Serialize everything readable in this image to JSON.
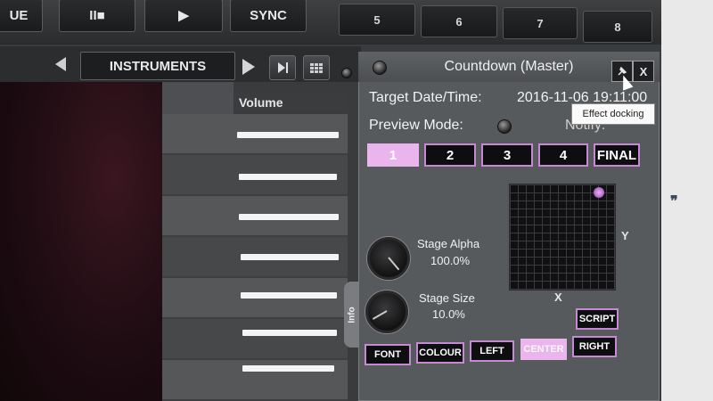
{
  "transport": {
    "cue_label": "UE",
    "play_pause_label": "II■",
    "play_label": "▶",
    "sync_label": "SYNC"
  },
  "hotcues": [
    "5",
    "6",
    "7",
    "8"
  ],
  "instruments": {
    "title": "INSTRUMENTS",
    "column_header": "Volume",
    "volume_levels": [
      0.95,
      0.92,
      0.93,
      0.92,
      0.9,
      0.88,
      0.86
    ]
  },
  "info_tab": "Info",
  "countdown": {
    "title": "Countdown (Master)",
    "target_label": "Target Date/Time:",
    "target_value": "2016-11-06 19:11:00",
    "preview_label": "Preview Mode:",
    "notify_label": "Notify:",
    "tooltip": "Effect docking",
    "close_label": "X",
    "stage_buttons": [
      "1",
      "2",
      "3",
      "4",
      "FINAL"
    ],
    "active_stage": "1",
    "stage_alpha_label": "Stage Alpha",
    "stage_alpha_value": "100.0%",
    "stage_size_label": "Stage Size",
    "stage_size_value": "10.0%",
    "script_label": "SCRIPT",
    "font_label": "FONT",
    "colour_label": "COLOUR",
    "left_label": "LEFT",
    "center_label": "CENTER",
    "right_label": "RIGHT",
    "x_label": "X",
    "y_label": "Y"
  },
  "side_glyph": "❞",
  "colors": {
    "accent": "#c58ad3",
    "active": "#e9b5ec",
    "panel": "#575a5d"
  }
}
